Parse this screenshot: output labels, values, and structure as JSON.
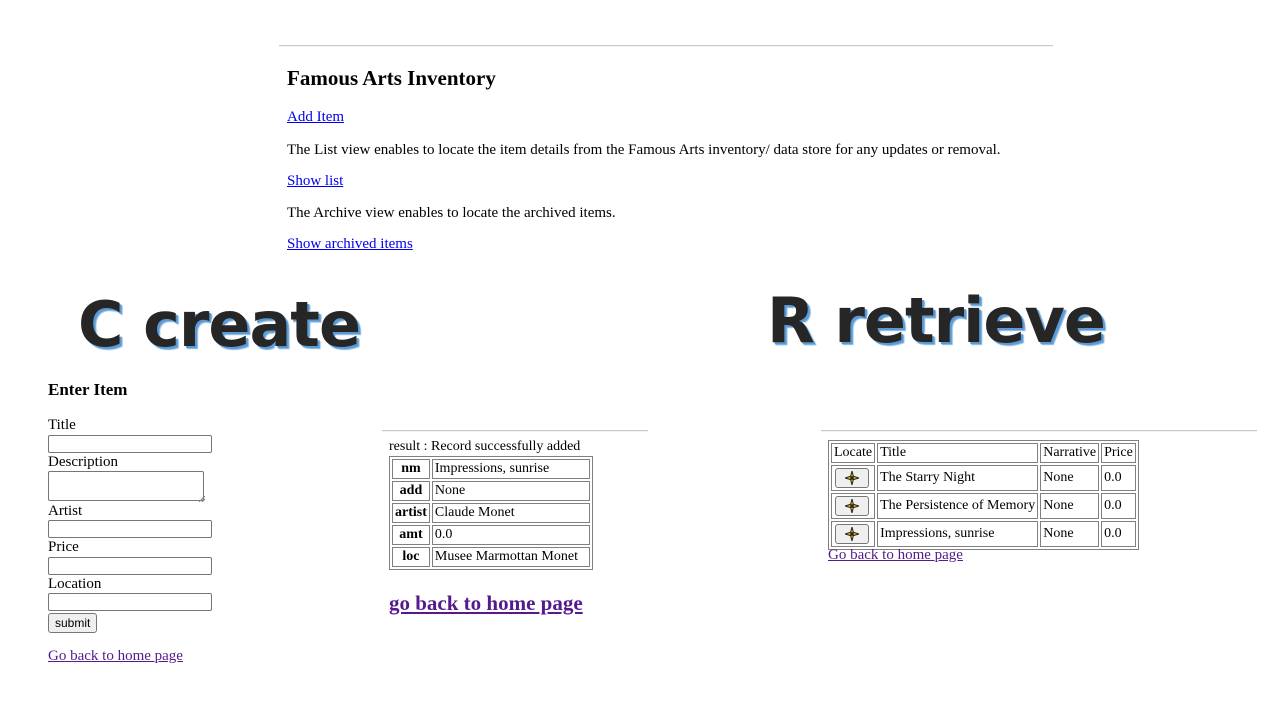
{
  "home": {
    "title": "Famous Arts Inventory",
    "add_item": "Add Item",
    "list_desc": "The List view enables to locate the item details from the Famous Arts inventory/ data store for any updates or removal.",
    "show_list": "Show list",
    "archive_desc": "The Archive view enables to locate the archived items.",
    "show_archived": "Show archived items"
  },
  "labels": {
    "create": "C create",
    "retrieve": "R retrieve"
  },
  "form": {
    "title": "Enter Item",
    "fields": [
      "Title",
      "Description",
      "Artist",
      "Price",
      "Location"
    ],
    "submit": "submit",
    "back": "Go back to home page"
  },
  "result": {
    "status": "result : Record successfully added",
    "rows": [
      {
        "key": "nm",
        "value": "Impressions, sunrise"
      },
      {
        "key": "add",
        "value": "None"
      },
      {
        "key": "artist",
        "value": "Claude Monet"
      },
      {
        "key": "amt",
        "value": "0.0"
      },
      {
        "key": "loc",
        "value": "Musee Marmottan Monet"
      }
    ],
    "back": "go back to home page"
  },
  "list": {
    "headers": [
      "Locate",
      "Title",
      "Narrative",
      "Price"
    ],
    "rows": [
      {
        "title": "The Starry Night",
        "narrative": "None",
        "price": "0.0"
      },
      {
        "title": "The Persistence of Memory",
        "narrative": "None",
        "price": "0.0"
      },
      {
        "title": "Impressions, sunrise",
        "narrative": "None",
        "price": "0.0"
      }
    ],
    "back": "Go back to home page"
  },
  "colors": {
    "link": "#0000ee",
    "visited_link": "#551a8b",
    "heading_shadow": "#5b9bd5"
  },
  "icons": {
    "locate": "sparkle-icon"
  }
}
